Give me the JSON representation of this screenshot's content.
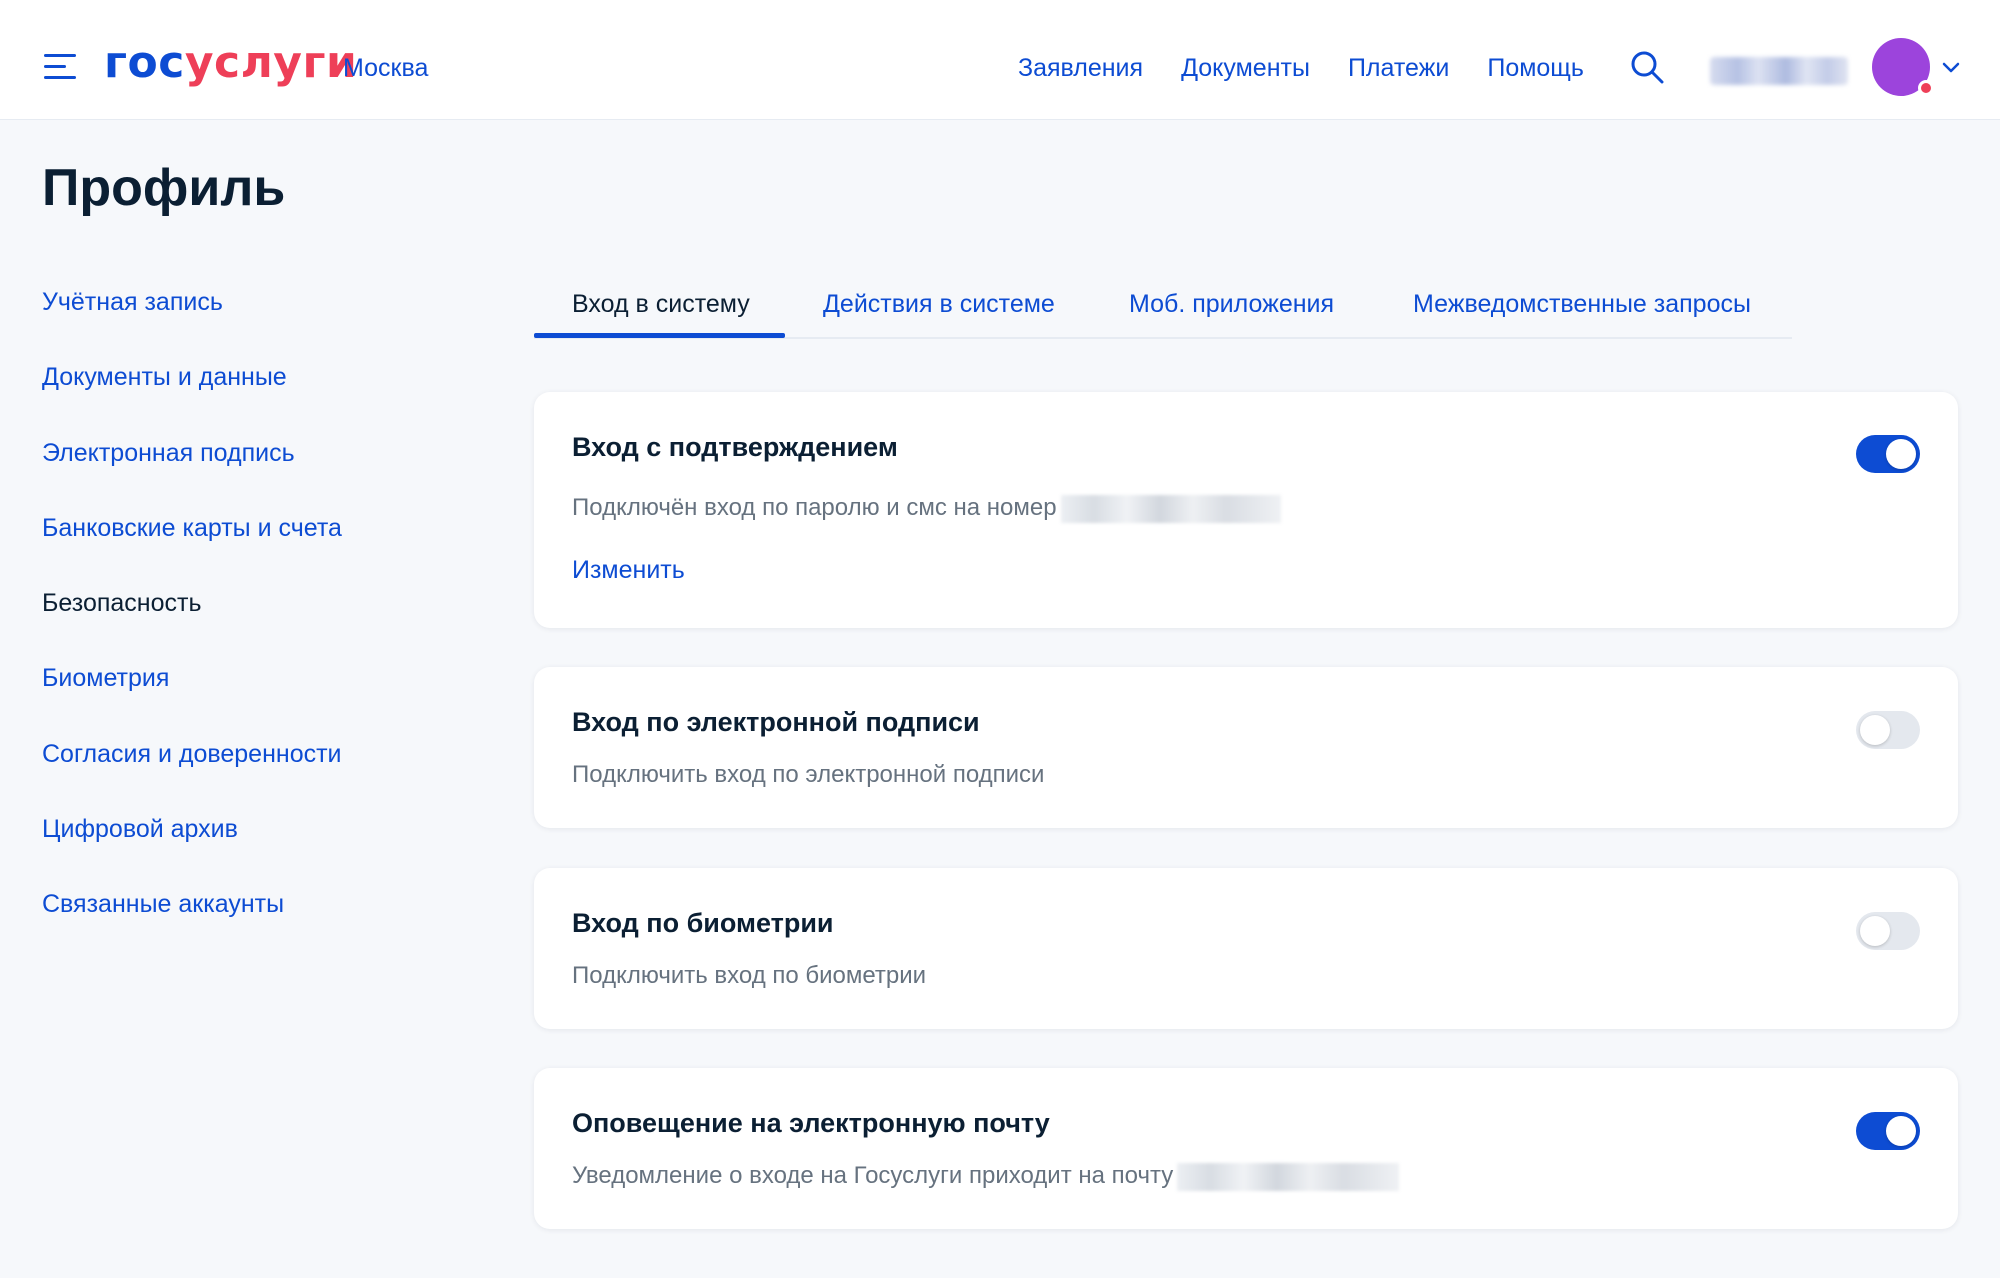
{
  "header": {
    "logo_part1": "гос",
    "logo_part2": "услуги",
    "city": "Москва",
    "nav": [
      "Заявления",
      "Документы",
      "Платежи",
      "Помощь"
    ],
    "brand_color": "#0d4cd3",
    "accent_color": "#ee3f58",
    "avatar_color": "#9c44dc"
  },
  "page": {
    "title": "Профиль"
  },
  "sidebar": {
    "items": [
      {
        "label": "Учётная запись"
      },
      {
        "label": "Документы и данные"
      },
      {
        "label": "Электронная подпись"
      },
      {
        "label": "Банковские карты и счета"
      },
      {
        "label": "Безопасность"
      },
      {
        "label": "Биометрия"
      },
      {
        "label": "Согласия и доверенности"
      },
      {
        "label": "Цифровой архив"
      },
      {
        "label": "Связанные аккаунты"
      }
    ],
    "active_index": 4
  },
  "tabs": [
    {
      "label": "Вход в систему"
    },
    {
      "label": "Действия в системе"
    },
    {
      "label": "Моб. приложения"
    },
    {
      "label": "Межведомственные запросы"
    }
  ],
  "cards": [
    {
      "title": "Вход с подтверждением",
      "desc": "Подключён вход по паролю и смс на номер",
      "link": "Изменить",
      "toggle_on": true
    },
    {
      "title": "Вход по электронной подписи",
      "desc": "Подключить вход по электронной подписи",
      "toggle_on": false
    },
    {
      "title": "Вход по биометрии",
      "desc": "Подключить вход по биометрии",
      "toggle_on": false
    },
    {
      "title": "Оповещение на электронную почту",
      "desc": "Уведомление о входе на Госуслуги приходит на почту",
      "toggle_on": true
    }
  ]
}
